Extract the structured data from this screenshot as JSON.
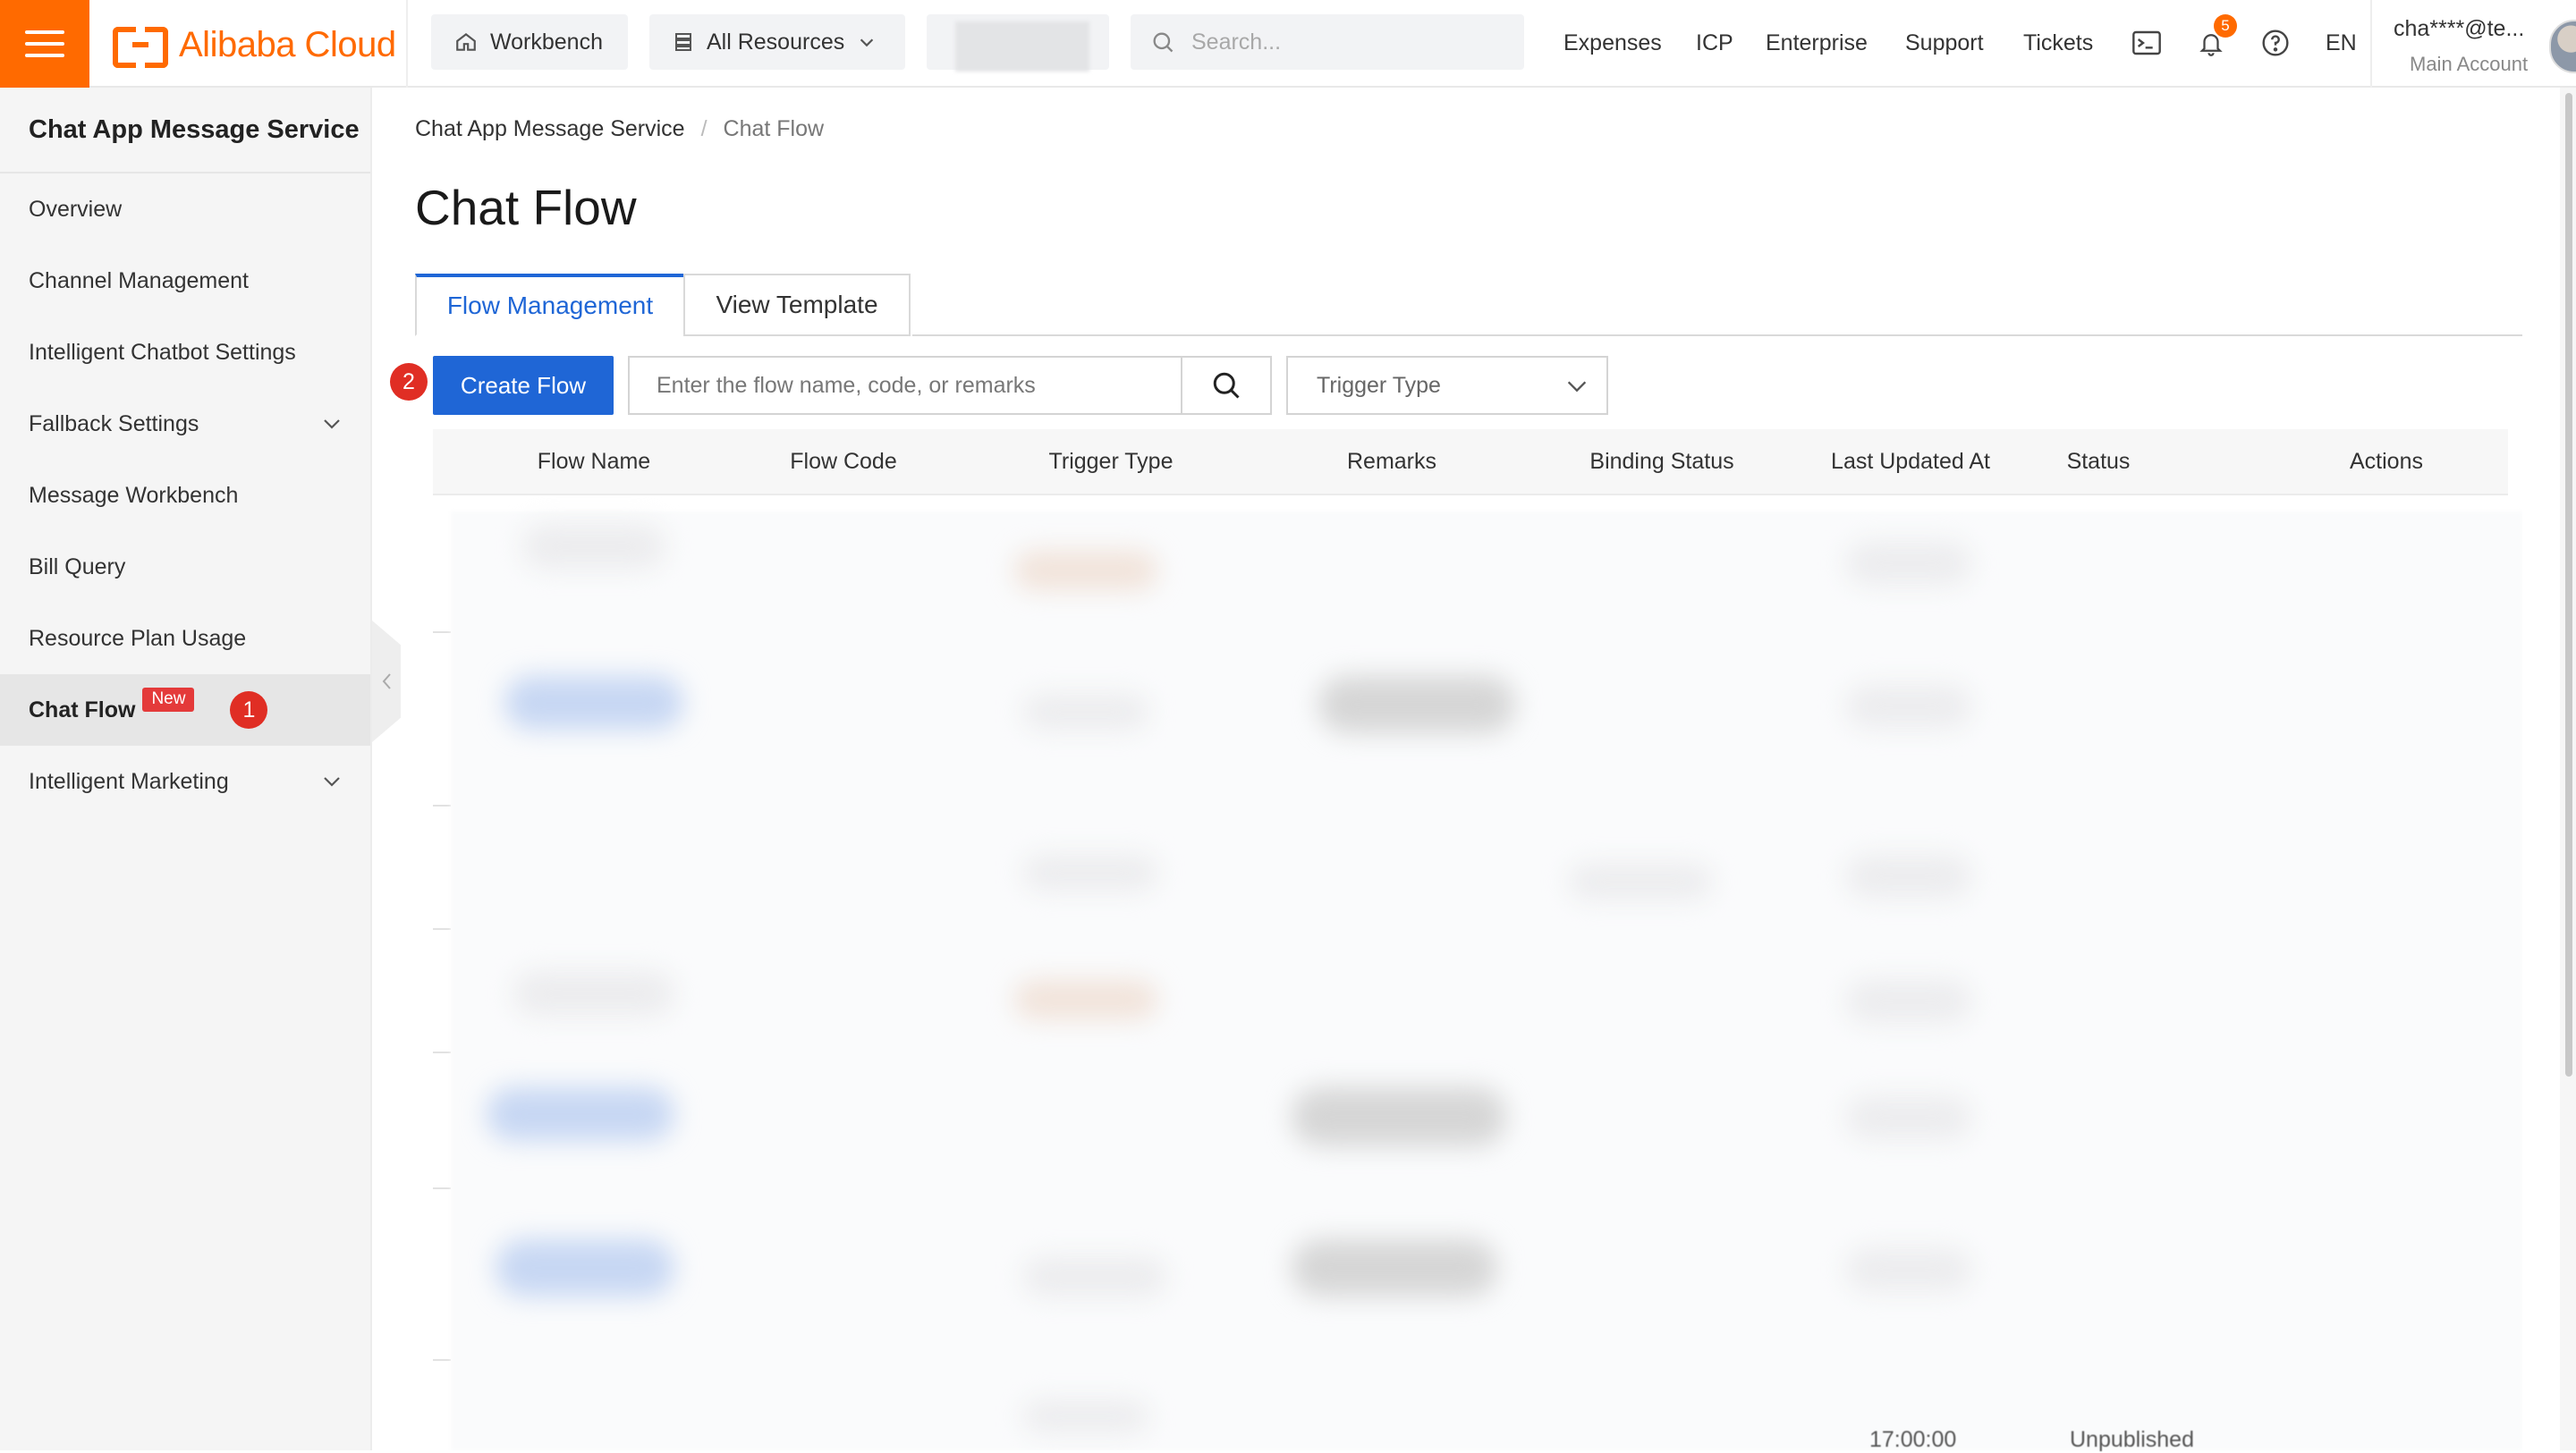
{
  "header": {
    "brand": "Alibaba Cloud",
    "workbench_label": "Workbench",
    "all_resources_label": "All Resources",
    "search_placeholder": "Search...",
    "links": {
      "expenses": "Expenses",
      "icp": "ICP",
      "enterprise": "Enterprise",
      "support": "Support",
      "tickets": "Tickets"
    },
    "notification_count": "5",
    "language": "EN",
    "account_name": "cha****@te...",
    "account_type": "Main Account"
  },
  "sidebar": {
    "title": "Chat App Message Service",
    "items": [
      {
        "label": "Overview"
      },
      {
        "label": "Channel Management"
      },
      {
        "label": "Intelligent Chatbot Settings"
      },
      {
        "label": "Fallback Settings"
      },
      {
        "label": "Message Workbench"
      },
      {
        "label": "Bill Query"
      },
      {
        "label": "Resource Plan Usage"
      },
      {
        "label": "Chat Flow",
        "badge": "New",
        "step": "1"
      },
      {
        "label": "Intelligent Marketing"
      }
    ]
  },
  "breadcrumb": {
    "root": "Chat App Message Service",
    "separator": "/",
    "current": "Chat Flow"
  },
  "page": {
    "title": "Chat Flow",
    "tabs": [
      {
        "label": "Flow Management",
        "active": true
      },
      {
        "label": "View Template",
        "active": false
      }
    ],
    "step_two": "2",
    "create_button": "Create Flow",
    "search_placeholder": "Enter the flow name, code, or remarks",
    "trigger_filter": "Trigger Type"
  },
  "table": {
    "columns": [
      "Flow Name",
      "Flow Code",
      "Trigger Type",
      "Remarks",
      "Binding Status",
      "Last Updated At",
      "Status",
      "Actions"
    ],
    "partial_footer_time": "17:00:00",
    "partial_footer_status": "Unpublished"
  },
  "colors": {
    "brand_orange": "#ff6a00",
    "primary_blue": "#1f66d6",
    "step_red": "#e02e24",
    "new_badge_red": "#e43a3a"
  }
}
